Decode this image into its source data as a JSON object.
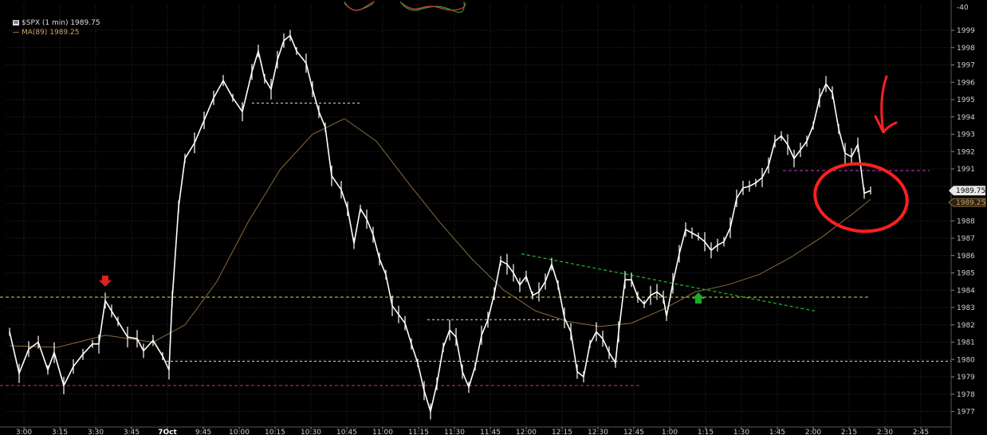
{
  "header": {
    "symbol_label": "$SPX (1 min) 1989.75",
    "ma_label": "MA(89) 1989.25"
  },
  "colors": {
    "background": "#000000",
    "price": "#ffffff",
    "ma": "#8a6a3c",
    "yellow_level": "#d8d84a",
    "red_level": "#c83c3c",
    "green_trend": "#1fae2a",
    "magenta_level": "#c040c0",
    "annotation_red": "#ff2020",
    "signal_up": "#1fa82a",
    "signal_down": "#e02020"
  },
  "chart_data": {
    "type": "line",
    "title": "",
    "xlabel": "",
    "ylabel": "",
    "ylim": [
      1976.5,
      2000
    ],
    "y_ticks": [
      1977,
      1978,
      1979,
      1980,
      1981,
      1982,
      1983,
      1984,
      1985,
      1986,
      1987,
      1988,
      1989,
      1990,
      1991,
      1992,
      1993,
      1994,
      1995,
      1996,
      1997,
      1998,
      1999
    ],
    "y_top_label": "-40",
    "x_tick_labels": [
      "3:00",
      "3:15",
      "3:30",
      "3:45",
      "7Oct",
      "9:45",
      "10:00",
      "10:15",
      "10:30",
      "10:45",
      "11:00",
      "11:15",
      "11:30",
      "11:45",
      "12:00",
      "12:15",
      "12:30",
      "12:45",
      "1:00",
      "1:15",
      "1:30",
      "1:45",
      "2:00",
      "2:15",
      "2:30",
      "2:45"
    ],
    "x_bold_label": "7Oct",
    "grid": true,
    "series": [
      {
        "name": "$SPX (1 min)",
        "last": "1989.75",
        "points": [
          [
            0,
            1981.6
          ],
          [
            3,
            1979.2
          ],
          [
            6,
            1980.6
          ],
          [
            9,
            1981.0
          ],
          [
            12,
            1979.4
          ],
          [
            14,
            1980.4
          ],
          [
            17,
            1978.5
          ],
          [
            20,
            1979.6
          ],
          [
            23,
            1980.3
          ],
          [
            26,
            1980.9
          ],
          [
            28,
            1980.9
          ],
          [
            30,
            1983.4
          ],
          [
            32,
            1982.8
          ],
          [
            34,
            1982.2
          ],
          [
            37,
            1981.3
          ],
          [
            40,
            1981.2
          ],
          [
            42,
            1980.5
          ],
          [
            45,
            1981.1
          ],
          [
            48,
            1980.2
          ],
          [
            50,
            1979.4
          ],
          [
            51,
            1983.5
          ],
          [
            53,
            1988.8
          ],
          [
            55,
            1991.6
          ],
          [
            58,
            1992.5
          ],
          [
            61,
            1993.8
          ],
          [
            64,
            1995.1
          ],
          [
            67,
            1996.1
          ],
          [
            70,
            1995.1
          ],
          [
            73,
            1994.3
          ],
          [
            76,
            1996.6
          ],
          [
            78,
            1997.8
          ],
          [
            80,
            1996.2
          ],
          [
            82,
            1995.6
          ],
          [
            84,
            1997.3
          ],
          [
            86,
            1998.4
          ],
          [
            88,
            1998.7
          ],
          [
            90,
            1997.8
          ],
          [
            93,
            1997.1
          ],
          [
            95,
            1995.6
          ],
          [
            97,
            1994.3
          ],
          [
            99,
            1993.4
          ],
          [
            101,
            1990.6
          ],
          [
            104,
            1989.8
          ],
          [
            106,
            1988.7
          ],
          [
            108,
            1986.7
          ],
          [
            110,
            1988.7
          ],
          [
            112,
            1988.1
          ],
          [
            114,
            1987.2
          ],
          [
            116,
            1985.8
          ],
          [
            118,
            1984.9
          ],
          [
            120,
            1983.1
          ],
          [
            122,
            1982.6
          ],
          [
            124,
            1982.1
          ],
          [
            126,
            1980.9
          ],
          [
            128,
            1979.8
          ],
          [
            130,
            1978.2
          ],
          [
            132,
            1977.0
          ],
          [
            134,
            1978.6
          ],
          [
            136,
            1980.7
          ],
          [
            138,
            1981.7
          ],
          [
            140,
            1981.3
          ],
          [
            142,
            1979.3
          ],
          [
            144,
            1978.4
          ],
          [
            146,
            1979.6
          ],
          [
            148,
            1981.4
          ],
          [
            150,
            1982.3
          ],
          [
            152,
            1983.8
          ],
          [
            154,
            1985.7
          ],
          [
            156,
            1985.5
          ],
          [
            158,
            1985.0
          ],
          [
            160,
            1984.3
          ],
          [
            162,
            1984.8
          ],
          [
            164,
            1983.7
          ],
          [
            166,
            1983.9
          ],
          [
            168,
            1984.5
          ],
          [
            170,
            1985.5
          ],
          [
            172,
            1984.3
          ],
          [
            174,
            1982.4
          ],
          [
            176,
            1981.6
          ],
          [
            178,
            1979.3
          ],
          [
            180,
            1979.0
          ],
          [
            182,
            1980.9
          ],
          [
            184,
            1981.6
          ],
          [
            186,
            1981.2
          ],
          [
            188,
            1980.4
          ],
          [
            190,
            1979.8
          ],
          [
            191,
            1981.6
          ],
          [
            193,
            1984.6
          ],
          [
            195,
            1984.6
          ],
          [
            197,
            1983.6
          ],
          [
            199,
            1983.2
          ],
          [
            201,
            1983.7
          ],
          [
            203,
            1983.9
          ],
          [
            205,
            1983.6
          ],
          [
            206,
            1982.5
          ],
          [
            208,
            1984.4
          ],
          [
            210,
            1986.1
          ],
          [
            212,
            1987.5
          ],
          [
            214,
            1987.3
          ],
          [
            216,
            1987.1
          ],
          [
            218,
            1986.8
          ],
          [
            220,
            1986.3
          ],
          [
            222,
            1986.6
          ],
          [
            224,
            1986.8
          ],
          [
            226,
            1987.6
          ],
          [
            228,
            1989.3
          ],
          [
            230,
            1989.9
          ],
          [
            232,
            1990.0
          ],
          [
            234,
            1990.2
          ],
          [
            236,
            1990.5
          ],
          [
            238,
            1991.2
          ],
          [
            240,
            1992.6
          ],
          [
            242,
            1992.9
          ],
          [
            244,
            1992.4
          ],
          [
            246,
            1991.6
          ],
          [
            248,
            1992.1
          ],
          [
            250,
            1992.6
          ],
          [
            252,
            1993.5
          ],
          [
            254,
            1995.1
          ],
          [
            256,
            1995.9
          ],
          [
            258,
            1995.4
          ],
          [
            260,
            1993.3
          ],
          [
            262,
            1991.9
          ],
          [
            264,
            1991.7
          ],
          [
            266,
            1992.4
          ],
          [
            268,
            1989.6
          ],
          [
            270,
            1989.75
          ]
        ]
      },
      {
        "name": "MA(89)",
        "last": "1989.25",
        "points": [
          [
            0,
            1980.8
          ],
          [
            15,
            1980.7
          ],
          [
            30,
            1981.4
          ],
          [
            45,
            1981.0
          ],
          [
            55,
            1982.0
          ],
          [
            65,
            1984.5
          ],
          [
            75,
            1988.0
          ],
          [
            85,
            1991.0
          ],
          [
            95,
            1993.0
          ],
          [
            105,
            1993.9
          ],
          [
            115,
            1992.6
          ],
          [
            125,
            1990.2
          ],
          [
            135,
            1987.9
          ],
          [
            145,
            1985.8
          ],
          [
            155,
            1984.0
          ],
          [
            165,
            1982.8
          ],
          [
            175,
            1982.2
          ],
          [
            185,
            1981.9
          ],
          [
            195,
            1982.1
          ],
          [
            205,
            1982.9
          ],
          [
            215,
            1983.9
          ],
          [
            225,
            1984.3
          ],
          [
            235,
            1984.9
          ],
          [
            245,
            1985.9
          ],
          [
            255,
            1987.1
          ],
          [
            265,
            1988.5
          ],
          [
            270,
            1989.25
          ]
        ]
      }
    ],
    "reference_lines": [
      {
        "kind": "yellow_dashed",
        "y": 1983.6
      },
      {
        "kind": "red_dashed",
        "y": 1978.5
      },
      {
        "kind": "white_dashed",
        "y": 1994.8
      },
      {
        "kind": "white_dashed",
        "y": 1982.3
      },
      {
        "kind": "white_dashed",
        "y": 1979.9
      },
      {
        "kind": "magenta_dashed",
        "y": 1990.9
      }
    ],
    "trend_line": {
      "from": [
        161,
        1986.1
      ],
      "to": [
        251,
        1982.8
      ]
    },
    "signals": [
      {
        "type": "sell",
        "at": [
          30,
          1984.2
        ]
      },
      {
        "type": "buy",
        "at": [
          216,
          1983.6
        ]
      }
    ]
  }
}
